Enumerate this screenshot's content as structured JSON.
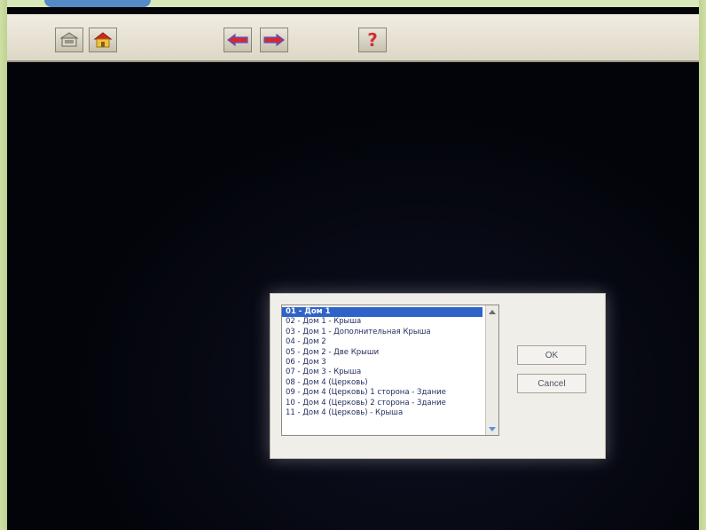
{
  "toolbar": {
    "buttons": [
      {
        "name": "back-to-list-icon"
      },
      {
        "name": "home-icon"
      },
      {
        "name": "arrow-left-icon"
      },
      {
        "name": "arrow-right-icon"
      },
      {
        "name": "help-icon"
      }
    ],
    "help_label": "?"
  },
  "dialog": {
    "list_items": [
      "01 - Дом 1",
      "02 - Дом 1 - Крыша",
      "03 - Дом 1 - Дополнительная Крыша",
      "04 - Дом 2",
      "05 - Дом 2 - Две Крыши",
      "06 - Дом 3",
      "07 - Дом 3 - Крыша",
      "08 - Дом 4 (Церковь)",
      "09 - Дом 4 (Церковь) 1 сторона - Здание",
      "10 - Дом 4 (Церковь) 2 сторона - Здание",
      "11 - Дом 4 (Церковь) - Крыша"
    ],
    "selected_index": 0,
    "ok_label": "OK",
    "cancel_label": "Cancel"
  },
  "colors": {
    "selection": "#2f63c8",
    "screen": "#03040a",
    "toolbar": "#e8e4d8"
  }
}
